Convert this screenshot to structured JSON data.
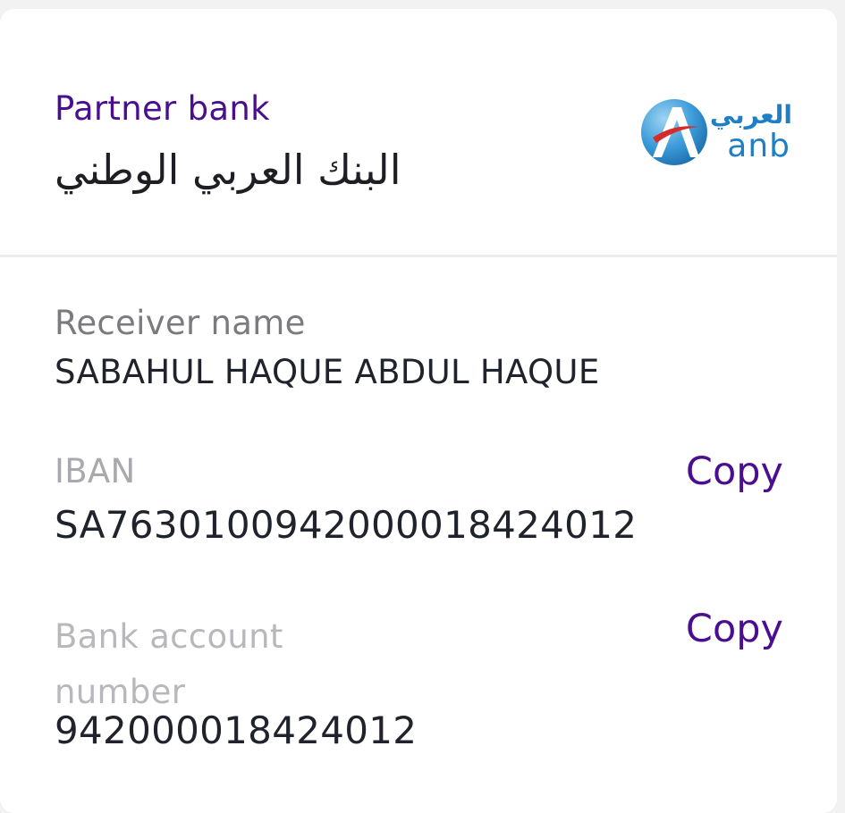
{
  "bank": {
    "label": "Partner bank",
    "name": "البنك العربي الوطني",
    "logo": {
      "arabic": "العربي",
      "latin": "anb",
      "colors": {
        "primary": "#1f7fc6",
        "accent": "#d62b2b"
      }
    }
  },
  "receiver": {
    "label": "Receiver name",
    "value": "SABAHUL HAQUE ABDUL HAQUE"
  },
  "iban": {
    "label": "IBAN",
    "value": "SA7630100942000018424012",
    "copy_label": "Copy"
  },
  "account": {
    "label": "Bank account number",
    "value": "942000018424012",
    "copy_label": "Copy"
  },
  "theme": {
    "accent": "#4a0f8f",
    "text": "#20232b"
  }
}
